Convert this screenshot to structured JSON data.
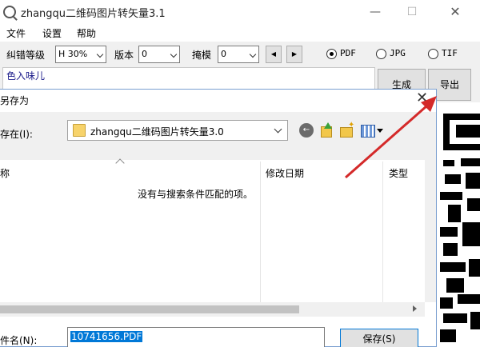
{
  "window": {
    "title": "zhangqu二维码图片转矢量3.1",
    "minimize": "—",
    "maximize": "☐",
    "close": "✕"
  },
  "menu": [
    "文件",
    "设置",
    "帮助"
  ],
  "toolbar": {
    "ecc_label": "纠错等级",
    "ecc_value": "H 30%",
    "version_label": "版本",
    "version_value": "0",
    "mask_label": "掩模",
    "mask_value": "0",
    "spin_left": "◀",
    "spin_right": "▶",
    "formats": [
      {
        "label": "PDF",
        "selected": true
      },
      {
        "label": "JPG",
        "selected": false
      },
      {
        "label": "TIF",
        "selected": false
      }
    ]
  },
  "input_text": "色入味儿",
  "buttons": {
    "generate": "生成",
    "export": "导出"
  },
  "dialog": {
    "title": "另存为",
    "close": "✕",
    "save_in_label": "存在(I):",
    "folder": "zhangqu二维码图片转矢量3.0",
    "back_icon": "←",
    "columns": [
      "称",
      "修改日期",
      "类型"
    ],
    "empty_message": "没有与搜索条件匹配的项。",
    "filename_label": "件名(N):",
    "filename": "10741656.PDF",
    "save_button": "保存(S)"
  },
  "colors": {
    "accent": "#0078d7",
    "annotation": "#d42a2a",
    "input_text": "#1a1a8a"
  }
}
